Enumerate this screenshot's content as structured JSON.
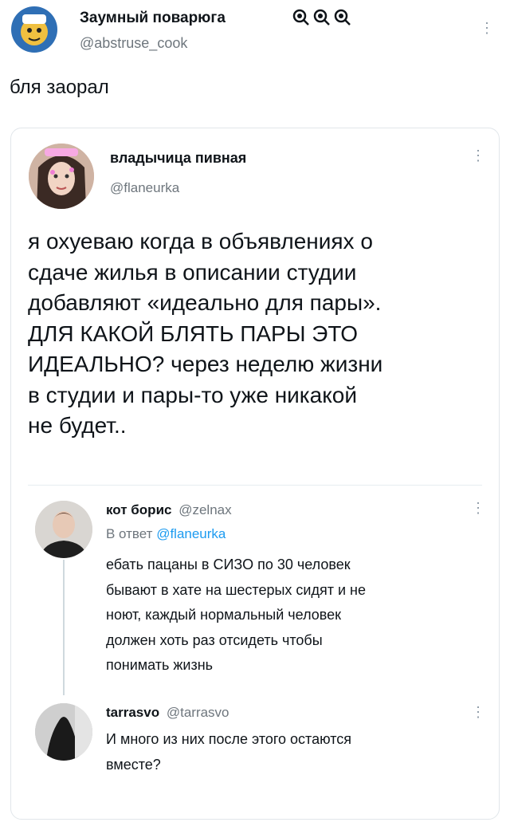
{
  "outer": {
    "name": "Заумный поварюга",
    "handle": "@abstruse_cook",
    "tweet_text": "бля заорал",
    "name_icons": [
      "magnifier-icon",
      "magnifier-icon",
      "magnifier-icon"
    ],
    "menu_icon": "more-icon"
  },
  "quoted": {
    "name": "владычица пивная",
    "handle": "@flaneurka",
    "lines": [
      "я охуеваю когда в объявлениях о",
      "сдаче жилья в описании студии",
      "добавляют «идеально для пары».",
      "ДЛЯ КАКОЙ БЛЯТЬ ПАРЫ ЭТО",
      "ИДЕАЛЬНО? через неделю жизни",
      "в студии и пары-то уже никакой",
      "не будет.."
    ],
    "replies": [
      {
        "name": "кот борис",
        "handle": "@zelnax",
        "reply_prefix": "В ответ",
        "reply_to": "@flaneurka",
        "lines": [
          "ебать пацаны в СИЗО по 30 человек",
          "бывают в хате на шестерых сидят и не",
          "ноют, каждый нормальный человек",
          "должен хоть раз отсидеть чтобы",
          "понимать жизнь"
        ]
      },
      {
        "name": "tarrasvo",
        "handle": "@tarrasvo",
        "lines": [
          "И много из них после этого остаются",
          "вместе?"
        ]
      }
    ]
  },
  "colors": {
    "text": "#0f1419",
    "secondary": "#6e767d",
    "link": "#1d9bf0",
    "border": "#e1e6ea"
  }
}
